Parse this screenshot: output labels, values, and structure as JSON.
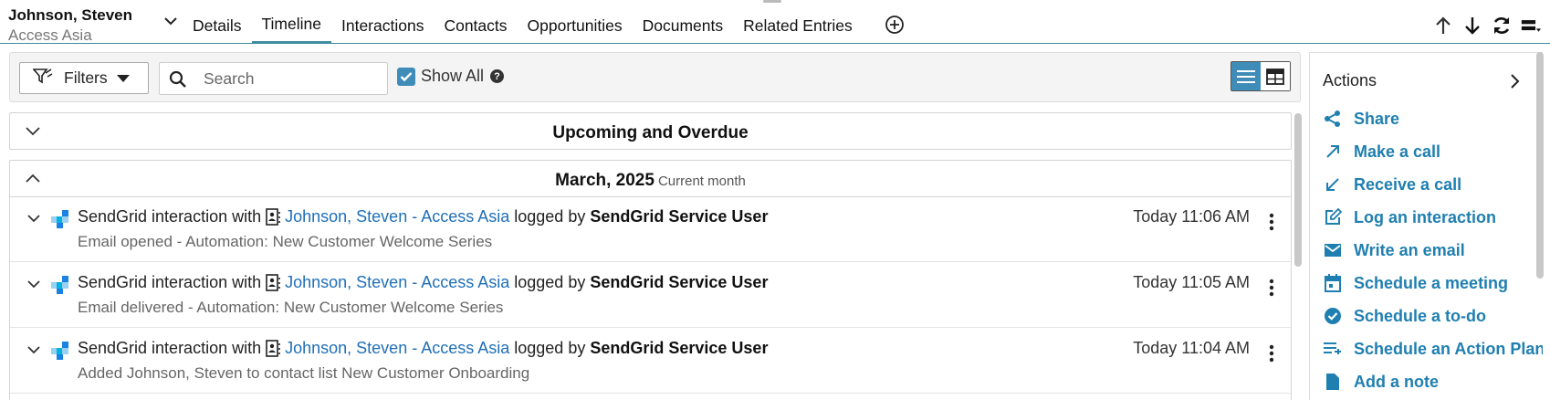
{
  "record": {
    "name": "Johnson, Steven",
    "company": "Access Asia"
  },
  "tabs": [
    {
      "label": "Details"
    },
    {
      "label": "Timeline"
    },
    {
      "label": "Interactions"
    },
    {
      "label": "Contacts"
    },
    {
      "label": "Opportunities"
    },
    {
      "label": "Documents"
    },
    {
      "label": "Related Entries"
    }
  ],
  "active_tab": "Timeline",
  "toolbar": {
    "filters_label": "Filters",
    "search_placeholder": "Search",
    "show_all_label": "Show All",
    "show_all_checked": true,
    "help_glyph": "?"
  },
  "sections": {
    "upcoming": "Upcoming and Overdue",
    "month": "March, 2025",
    "month_sub": "Current month"
  },
  "items": [
    {
      "prefix": "SendGrid interaction with",
      "contact": "Johnson, Steven - Access Asia",
      "logged_by": "logged by",
      "user": "SendGrid Service User",
      "detail": "Email opened - Automation: New Customer Welcome Series",
      "time": "Today 11:06 AM"
    },
    {
      "prefix": "SendGrid interaction with",
      "contact": "Johnson, Steven - Access Asia",
      "logged_by": "logged by",
      "user": "SendGrid Service User",
      "detail": "Email delivered - Automation: New Customer Welcome Series",
      "time": "Today 11:05 AM"
    },
    {
      "prefix": "SendGrid interaction with",
      "contact": "Johnson, Steven - Access Asia",
      "logged_by": "logged by",
      "user": "SendGrid Service User",
      "detail": "Added Johnson, Steven to contact list New Customer Onboarding",
      "time": "Today 11:04 AM"
    }
  ],
  "actions": {
    "title": "Actions",
    "items": [
      {
        "label": "Share",
        "icon": "share-icon"
      },
      {
        "label": "Make a call",
        "icon": "outgoing-call-icon"
      },
      {
        "label": "Receive a call",
        "icon": "incoming-call-icon"
      },
      {
        "label": "Log an interaction",
        "icon": "edit-icon"
      },
      {
        "label": "Write an email",
        "icon": "email-icon"
      },
      {
        "label": "Schedule a meeting",
        "icon": "calendar-icon"
      },
      {
        "label": "Schedule a to-do",
        "icon": "check-circle-icon"
      },
      {
        "label": "Schedule an Action Plan",
        "icon": "action-plan-icon"
      },
      {
        "label": "Add a note",
        "icon": "note-icon"
      }
    ]
  },
  "colors": {
    "accent": "#3f8c9e",
    "link": "#1f6fb8",
    "action": "#1f7fb0",
    "toggle_active": "#3f8cb8"
  }
}
